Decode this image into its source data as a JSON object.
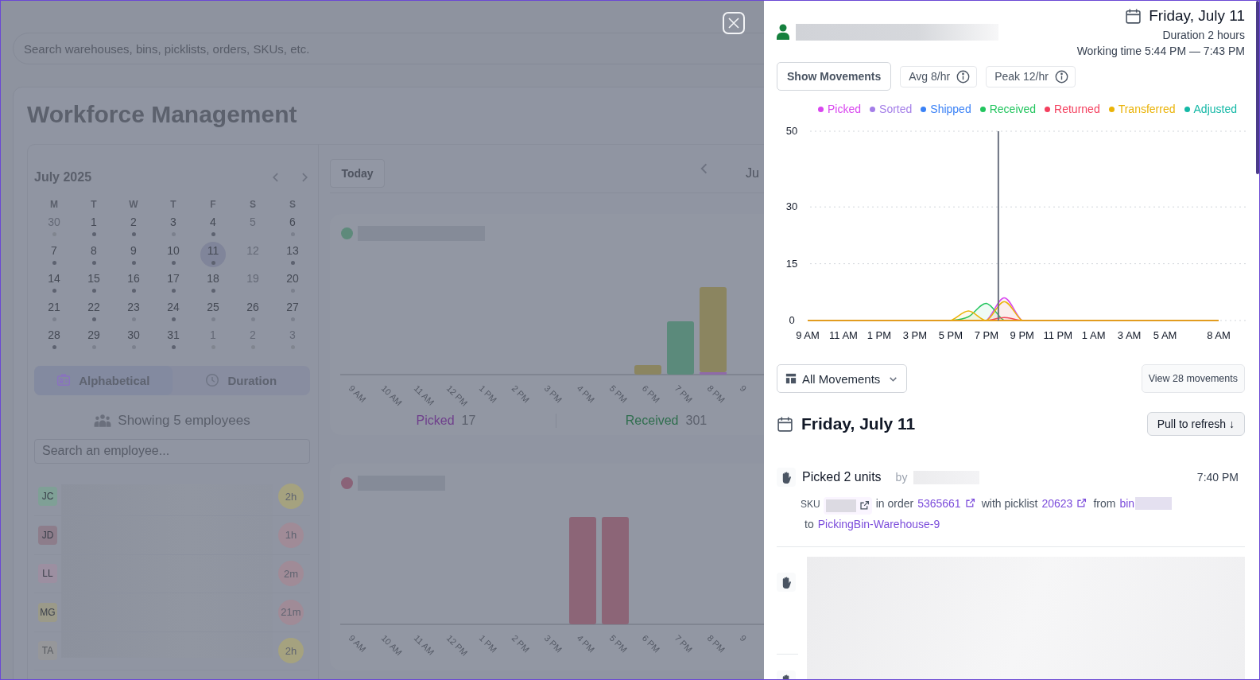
{
  "background": {
    "search": {
      "placeholder": "Search warehouses, bins, picklists, orders, SKUs, etc."
    },
    "title": "Workforce Management",
    "calendar": {
      "month": "July 2025",
      "weekdays": [
        "M",
        "T",
        "W",
        "T",
        "F",
        "S",
        "S"
      ],
      "days": [
        {
          "day": "30",
          "muted": true,
          "has_dot": true,
          "dark_dot": false,
          "selected": false
        },
        {
          "day": "1",
          "muted": false,
          "has_dot": true,
          "dark_dot": true,
          "selected": false
        },
        {
          "day": "2",
          "muted": false,
          "has_dot": true,
          "dark_dot": true,
          "selected": false
        },
        {
          "day": "3",
          "muted": false,
          "has_dot": true,
          "dark_dot": false,
          "selected": false
        },
        {
          "day": "4",
          "muted": false,
          "has_dot": true,
          "dark_dot": true,
          "selected": false
        },
        {
          "day": "5",
          "muted": true,
          "has_dot": false,
          "selected": false
        },
        {
          "day": "6",
          "muted": false,
          "has_dot": true,
          "dark_dot": false,
          "selected": false
        },
        {
          "day": "7",
          "muted": false,
          "has_dot": true,
          "dark_dot": true,
          "selected": false
        },
        {
          "day": "8",
          "muted": false,
          "has_dot": true,
          "dark_dot": true,
          "selected": false
        },
        {
          "day": "9",
          "muted": false,
          "has_dot": true,
          "dark_dot": true,
          "selected": false
        },
        {
          "day": "10",
          "muted": false,
          "has_dot": true,
          "dark_dot": true,
          "selected": false
        },
        {
          "day": "11",
          "muted": false,
          "has_dot": true,
          "dark_dot": true,
          "selected": true
        },
        {
          "day": "12",
          "muted": true,
          "has_dot": false,
          "selected": false
        },
        {
          "day": "13",
          "muted": false,
          "has_dot": true,
          "dark_dot": true,
          "selected": false
        },
        {
          "day": "14",
          "muted": false,
          "has_dot": true,
          "dark_dot": true,
          "selected": false
        },
        {
          "day": "15",
          "muted": false,
          "has_dot": true,
          "dark_dot": true,
          "selected": false
        },
        {
          "day": "16",
          "muted": false,
          "has_dot": true,
          "dark_dot": true,
          "selected": false
        },
        {
          "day": "17",
          "muted": false,
          "has_dot": true,
          "dark_dot": true,
          "selected": false
        },
        {
          "day": "18",
          "muted": false,
          "has_dot": true,
          "dark_dot": true,
          "selected": false
        },
        {
          "day": "19",
          "muted": true,
          "has_dot": false,
          "selected": false
        },
        {
          "day": "20",
          "muted": false,
          "has_dot": true,
          "dark_dot": false,
          "selected": false
        },
        {
          "day": "21",
          "muted": false,
          "has_dot": true,
          "dark_dot": false,
          "selected": false
        },
        {
          "day": "22",
          "muted": false,
          "has_dot": true,
          "dark_dot": true,
          "selected": false
        },
        {
          "day": "23",
          "muted": false,
          "has_dot": true,
          "dark_dot": false,
          "selected": false
        },
        {
          "day": "24",
          "muted": false,
          "has_dot": true,
          "dark_dot": true,
          "selected": false
        },
        {
          "day": "25",
          "muted": false,
          "has_dot": true,
          "dark_dot": false,
          "selected": false
        },
        {
          "day": "26",
          "muted": false,
          "has_dot": true,
          "dark_dot": false,
          "selected": false
        },
        {
          "day": "27",
          "muted": false,
          "has_dot": true,
          "dark_dot": false,
          "selected": false
        },
        {
          "day": "28",
          "muted": false,
          "has_dot": true,
          "dark_dot": true,
          "selected": false
        },
        {
          "day": "29",
          "muted": false,
          "has_dot": true,
          "dark_dot": false,
          "selected": false
        },
        {
          "day": "30",
          "muted": false,
          "has_dot": true,
          "dark_dot": false,
          "selected": false
        },
        {
          "day": "31",
          "muted": false,
          "has_dot": true,
          "dark_dot": true,
          "selected": false
        },
        {
          "day": "1",
          "muted": true,
          "has_dot": true,
          "dark_dot": false,
          "selected": false
        },
        {
          "day": "2",
          "muted": true,
          "has_dot": true,
          "dark_dot": false,
          "selected": false
        },
        {
          "day": "3",
          "muted": true,
          "has_dot": true,
          "dark_dot": false,
          "selected": false
        }
      ]
    },
    "sort_options": [
      {
        "label": "Alphabetical",
        "selected": true
      },
      {
        "label": "Duration",
        "selected": false
      }
    ],
    "employee_count": "Showing 5 employees",
    "employee_search": {
      "placeholder": "Search an employee..."
    },
    "employees": [
      {
        "initials": "JC",
        "color": "#7fa096",
        "badge": {
          "text": "2h",
          "color": "#a5a27f"
        }
      },
      {
        "initials": "JD",
        "color": "#8d7d8b",
        "badge": {
          "text": "1h",
          "color": "#a08b97"
        }
      },
      {
        "initials": "LL",
        "color": "#9c8fa1",
        "badge": {
          "text": "2m",
          "color": "#a08b97"
        }
      },
      {
        "initials": "MG",
        "color": "#9b9a89",
        "badge": {
          "text": "21m",
          "color": "#a08b97"
        }
      },
      {
        "initials": "TA",
        "color": "#96979a",
        "badge": {
          "text": "2h",
          "color": "#a5a27f"
        }
      }
    ],
    "today_button": "Today",
    "period_label": "Ju",
    "cards": [
      {
        "color": "#5e8a7b",
        "x_labels": [
          "9 AM",
          "10 AM",
          "11 AM",
          "12 PM",
          "1 PM",
          "2 PM",
          "3 PM",
          "4 PM",
          "5 PM",
          "6 PM",
          "7 PM",
          "8 PM",
          "9"
        ],
        "stats": [
          {
            "label": "Picked",
            "value": "17",
            "color": "#6f3f8c"
          },
          {
            "label": "Received",
            "value": "301",
            "color": "#2f6e4e"
          }
        ]
      },
      {
        "color": "#8a6378",
        "x_labels": [
          "9 AM",
          "10 AM",
          "11 AM",
          "12 PM",
          "1 PM",
          "2 PM",
          "3 PM",
          "4 PM",
          "5 PM",
          "6 PM",
          "7 PM",
          "8 PM",
          "9"
        ]
      }
    ]
  },
  "drawer": {
    "date": "Friday, July 11",
    "duration": "Duration 2 hours",
    "working_time": "Working time 5:44 PM — 7:43 PM",
    "buttons": [
      {
        "label": "Show Movements",
        "kind": "button"
      },
      {
        "label": "Avg 8/hr",
        "kind": "info"
      },
      {
        "label": "Peak 12/hr",
        "kind": "info"
      }
    ],
    "chart_data": {
      "type": "area",
      "categories": [
        "9 AM",
        null,
        "11 AM",
        null,
        "1 PM",
        null,
        "3 PM",
        null,
        "5 PM",
        null,
        "7 PM",
        null,
        "9 PM",
        null,
        "11 PM",
        null,
        "1 AM",
        null,
        "3 AM",
        null,
        "5 AM",
        null,
        null,
        "8 AM"
      ],
      "ylim": [
        0,
        50
      ],
      "yticks": [
        0,
        15,
        30,
        50
      ],
      "series": [
        {
          "name": "Picked",
          "color": "#d946ef",
          "values": [
            0,
            0,
            0,
            0,
            0,
            0,
            0,
            0,
            0,
            0,
            0,
            6,
            0,
            0,
            0,
            0,
            0,
            0,
            0,
            0,
            0,
            0,
            0,
            0
          ]
        },
        {
          "name": "Sorted",
          "color": "#a47ee8",
          "values": [
            null,
            null,
            null,
            null,
            null,
            null,
            null,
            null,
            null,
            null,
            null,
            null,
            null,
            null,
            null,
            null,
            null,
            null,
            null,
            null,
            null,
            null,
            null,
            null
          ]
        },
        {
          "name": "Shipped",
          "color": "#3b82f6",
          "values": [
            null,
            null,
            null,
            null,
            null,
            null,
            null,
            null,
            null,
            null,
            null,
            null,
            null,
            null,
            null,
            null,
            null,
            null,
            null,
            null,
            null,
            null,
            null,
            null
          ]
        },
        {
          "name": "Received",
          "color": "#22c55e",
          "values": [
            0,
            0,
            0,
            0,
            0,
            0,
            0,
            0,
            0,
            1,
            4.5,
            0,
            0,
            0,
            0,
            0,
            0,
            0,
            0,
            0,
            0,
            0,
            0,
            0
          ]
        },
        {
          "name": "Returned",
          "color": "#f43f5e",
          "values": [
            0,
            0,
            0,
            0,
            0,
            0,
            0,
            0,
            0,
            0,
            0,
            0.8,
            0,
            0,
            0,
            0,
            0,
            0,
            0,
            0,
            0,
            0,
            0,
            0
          ]
        },
        {
          "name": "Transferred",
          "color": "#eab308",
          "values": [
            0,
            0,
            0,
            0,
            0,
            0,
            0,
            0,
            0,
            2.5,
            0,
            5,
            0,
            0,
            0,
            0,
            0,
            0,
            0,
            0,
            0,
            0,
            0,
            0
          ]
        },
        {
          "name": "Adjusted",
          "color": "#14b8a6",
          "values": [
            null,
            null,
            null,
            null,
            null,
            null,
            null,
            null,
            null,
            null,
            null,
            null,
            null,
            null,
            null,
            null,
            null,
            null,
            null,
            null,
            null,
            null,
            null,
            null
          ]
        }
      ]
    },
    "filter": "All Movements",
    "view_button": "View 28 movements",
    "section_date": "Friday, July 11",
    "refresh_button": "Pull to refresh ↓",
    "movements": [
      {
        "title": "Picked 2 units",
        "by": "by",
        "time": "7:40 PM",
        "details": [
          {
            "kind": "label",
            "text": "SKU"
          },
          {
            "kind": "redacted",
            "external": true
          },
          {
            "kind": "text",
            "text": "in order"
          },
          {
            "kind": "link",
            "text": "5365661",
            "external": true
          },
          {
            "kind": "text",
            "text": "with picklist"
          },
          {
            "kind": "link",
            "text": "20623",
            "external": true
          },
          {
            "kind": "text",
            "text": "from"
          },
          {
            "kind": "link",
            "text": "bin",
            "external": false
          },
          {
            "kind": "redacted",
            "external": false
          },
          {
            "kind": "text",
            "text": "to"
          },
          {
            "kind": "link",
            "text": "PickingBin-Warehouse-9",
            "external": false
          }
        ]
      }
    ]
  }
}
